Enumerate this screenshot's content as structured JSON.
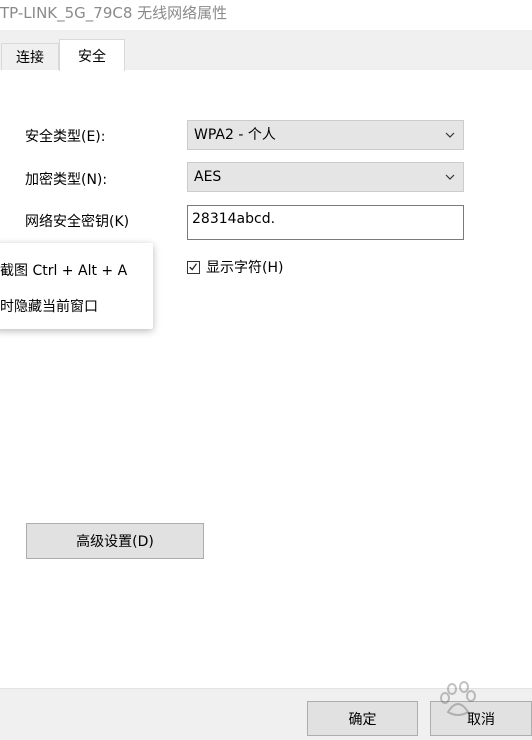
{
  "window": {
    "title": "TP-LINK_5G_79C8 无线网络属性"
  },
  "tabs": [
    {
      "label": "连接",
      "active": false
    },
    {
      "label": "安全",
      "active": true
    }
  ],
  "security": {
    "security_type_label": "安全类型(E):",
    "security_type_value": "WPA2 - 个人",
    "encryption_type_label": "加密类型(N):",
    "encryption_type_value": "AES",
    "key_label": "网络安全密钥(K)",
    "key_value": "28314abcd.",
    "show_chars_label": "显示字符(H)",
    "show_chars_checked": true,
    "advanced_button": "高级设置(D)"
  },
  "popup": {
    "items": [
      "截图 Ctrl + Alt + A",
      "时隐藏当前窗口"
    ]
  },
  "footer": {
    "ok_label": "确定",
    "cancel_label": "取消"
  },
  "icons": {
    "dropdown": "chevron-down-icon",
    "check": "checkmark-icon"
  }
}
